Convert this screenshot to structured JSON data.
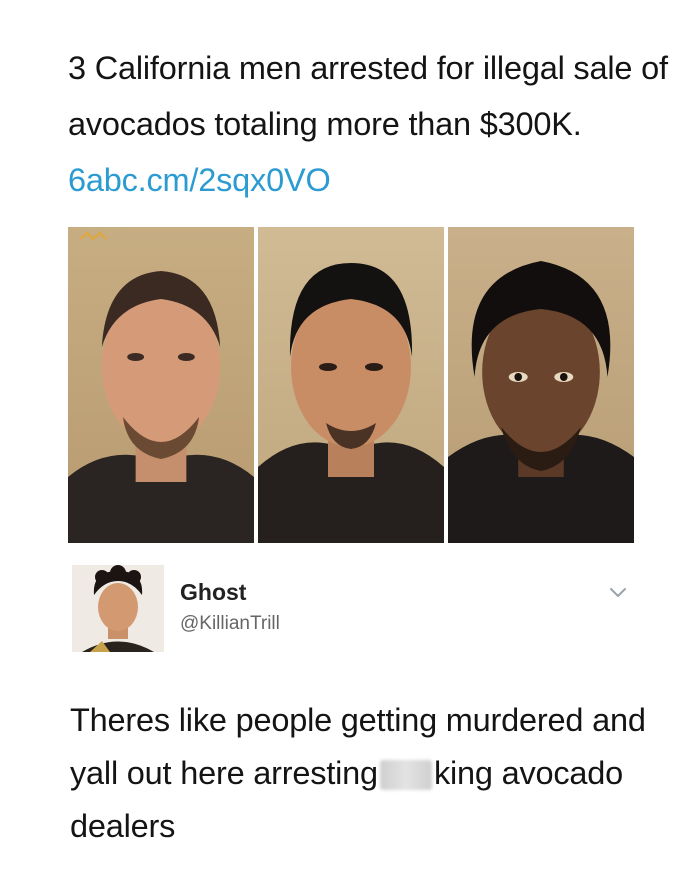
{
  "headline": {
    "text": "3 California men arrested for illegal sale of avocados totaling more than $300K.",
    "link": "6abc.cm/2sqx0VO"
  },
  "photos": [
    {
      "label": "mugshot-1"
    },
    {
      "label": "mugshot-2"
    },
    {
      "label": "mugshot-3"
    }
  ],
  "tweet": {
    "display_name": "Ghost",
    "handle": "@KillianTrill",
    "text_before": "Theres like people getting murdered and yall out here arresting",
    "text_after": "king avocado dealers",
    "menu_icon": "chevron-down-icon"
  },
  "colors": {
    "link": "#2b9bd1",
    "text": "#141414",
    "handle": "#666666"
  }
}
